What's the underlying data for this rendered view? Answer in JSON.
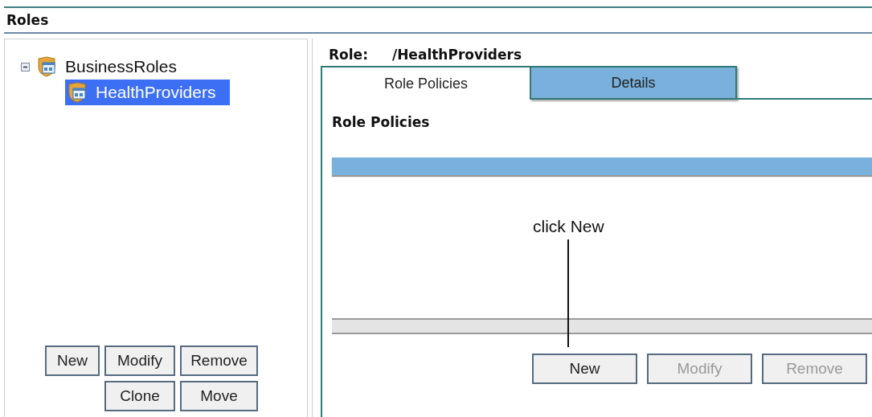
{
  "title": "Roles",
  "tree": [
    {
      "label": "BusinessRoles",
      "expanded": true,
      "selected": false,
      "children": [
        {
          "label": "HealthProviders",
          "selected": true
        }
      ]
    }
  ],
  "left_buttons": [
    [
      {
        "label": "New",
        "disabled": false
      },
      {
        "label": "Modify",
        "disabled": false
      },
      {
        "label": "Remove",
        "disabled": false
      }
    ],
    [
      {
        "label": "Clone",
        "disabled": false
      },
      {
        "label": "Move",
        "disabled": false
      }
    ]
  ],
  "role": {
    "label": "Role:",
    "value": "/HealthProviders"
  },
  "tabs": [
    {
      "label": "Role Policies",
      "selected": true
    },
    {
      "label": "Details",
      "selected": false
    }
  ],
  "section_title": "Role Policies",
  "annotation": "click New",
  "buttons": [
    {
      "label": "New",
      "disabled": false
    },
    {
      "label": "Modify",
      "disabled": true
    },
    {
      "label": "Remove",
      "disabled": true
    }
  ]
}
